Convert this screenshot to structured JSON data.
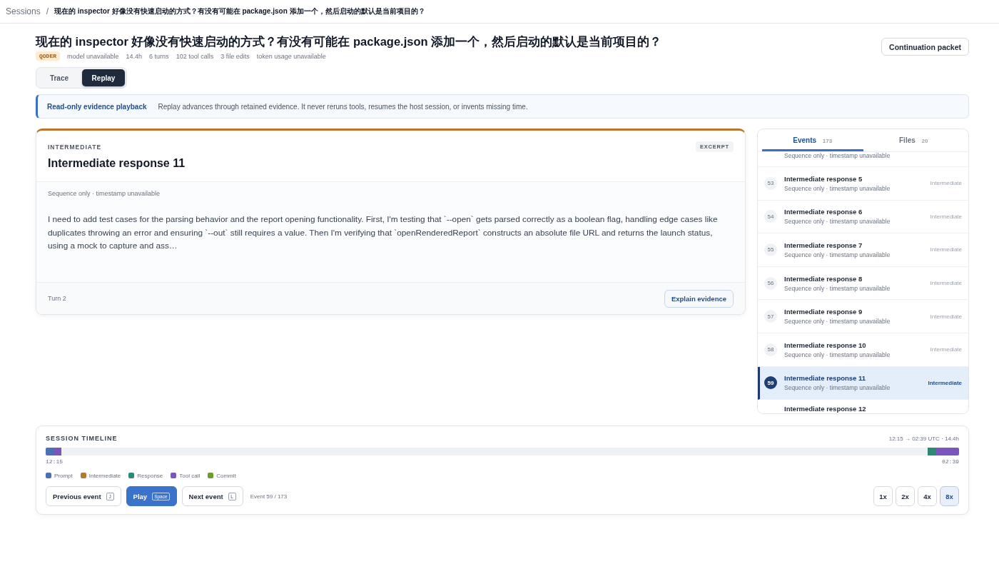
{
  "breadcrumb": {
    "root": "Sessions",
    "separator": "/",
    "current": "现在的 inspector 好像没有快速启动的方式？有没有可能在 package.json 添加一个，然后启动的默认是当前项目的？"
  },
  "header": {
    "title": "现在的 inspector 好像没有快速启动的方式？有没有可能在 package.json 添加一个，然后启动的默认是当前项目的？",
    "badge": "QODER",
    "meta": [
      "model unavailable",
      "14.4h",
      "6 turns",
      "102 tool calls",
      "3 file edits",
      "token usage unavailable"
    ],
    "action": "Continuation packet"
  },
  "view_tabs": [
    {
      "label": "Trace",
      "selected": false
    },
    {
      "label": "Replay",
      "selected": true
    }
  ],
  "notice": {
    "title": "Read-only evidence playback",
    "text": "Replay advances through retained evidence. It never reruns tools, resumes the host session, or invents missing time."
  },
  "event_card": {
    "color": "#b8772c",
    "category": "INTERMEDIATE",
    "title": "Intermediate response 11",
    "tag": "EXCERPT",
    "timing": "Sequence only · timestamp unavailable",
    "body": "I need to add test cases for the parsing behavior and the report opening functionality. First, I'm testing that `--open` gets parsed correctly as a boolean flag, handling edge cases like duplicates throwing an error and ensuring `--out` still requires a value. Then I'm verifying that `openRenderedReport` constructs an absolute file URL and returns the launch status, using a mock to capture and ass…",
    "turn": "Turn 2",
    "action": "Explain evidence"
  },
  "side_panel": {
    "tabs": [
      {
        "label": "Events",
        "count": "173",
        "selected": true
      },
      {
        "label": "Files",
        "count": "20",
        "selected": false
      }
    ],
    "events": [
      {
        "kind": "tail",
        "subtitle": "Sequence only · timestamp unavailable",
        "selected": false
      },
      {
        "kind": "full",
        "number": "53",
        "title": "Intermediate response 5",
        "subtitle": "Sequence only · timestamp unavailable",
        "type": "Intermediate",
        "selected": false
      },
      {
        "kind": "full",
        "number": "54",
        "title": "Intermediate response 6",
        "subtitle": "Sequence only · timestamp unavailable",
        "type": "Intermediate",
        "selected": false
      },
      {
        "kind": "full",
        "number": "55",
        "title": "Intermediate response 7",
        "subtitle": "Sequence only · timestamp unavailable",
        "type": "Intermediate",
        "selected": false
      },
      {
        "kind": "full",
        "number": "56",
        "title": "Intermediate response 8",
        "subtitle": "Sequence only · timestamp unavailable",
        "type": "Intermediate",
        "selected": false
      },
      {
        "kind": "full",
        "number": "57",
        "title": "Intermediate response 9",
        "subtitle": "Sequence only · timestamp unavailable",
        "type": "Intermediate",
        "selected": false
      },
      {
        "kind": "full",
        "number": "58",
        "title": "Intermediate response 10",
        "subtitle": "Sequence only · timestamp unavailable",
        "type": "Intermediate",
        "selected": false
      },
      {
        "kind": "full",
        "number": "59",
        "title": "Intermediate response 11",
        "subtitle": "Sequence only · timestamp unavailable",
        "type": "Intermediate",
        "selected": true
      },
      {
        "kind": "head",
        "title": "Intermediate response 12",
        "selected": false
      }
    ]
  },
  "timeline": {
    "title": "SESSION TIMELINE",
    "range": "12:15 → 02:39 UTC · 14.4h",
    "start_segments": [
      {
        "color": "#4a70b6"
      },
      {
        "color": "#7a55bb"
      }
    ],
    "end_segments": [
      {
        "color": "#2a8a74"
      },
      {
        "color": "#7a55bb"
      },
      {
        "color": "#7a55bb"
      },
      {
        "color": "#7a55bb"
      }
    ],
    "start_label": "12:15",
    "end_label": "02:39",
    "legend": [
      {
        "label": "Prompt",
        "color": "#4a70b6"
      },
      {
        "label": "Intermediate",
        "color": "#b8772c"
      },
      {
        "label": "Response",
        "color": "#2a8a74"
      },
      {
        "label": "Tool call",
        "color": "#7a55bb"
      },
      {
        "label": "Commit",
        "color": "#6e9c2c"
      }
    ]
  },
  "controls": {
    "previous": {
      "label": "Previous event",
      "key": "J"
    },
    "play": {
      "label": "Play",
      "key": "Space"
    },
    "next": {
      "label": "Next event",
      "key": "L"
    },
    "position": "Event 59 / 173",
    "speeds": [
      {
        "label": "1x",
        "selected": false
      },
      {
        "label": "2x",
        "selected": false
      },
      {
        "label": "4x",
        "selected": false
      },
      {
        "label": "8x",
        "selected": true
      }
    ]
  }
}
